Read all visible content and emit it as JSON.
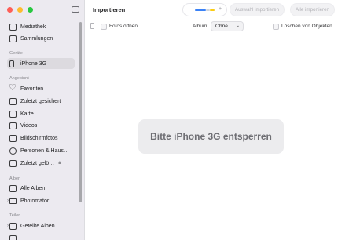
{
  "window": {
    "title": "Importieren"
  },
  "sidebar": {
    "library": [
      {
        "label": "Mediathek",
        "icon": "photos-library-icon"
      },
      {
        "label": "Sammlungen",
        "icon": "collections-icon"
      }
    ],
    "devices_header": "Geräte",
    "devices": [
      {
        "label": "iPhone 3G",
        "icon": "iphone-icon",
        "selected": true
      }
    ],
    "pinned_header": "Angepinnt",
    "pinned": [
      {
        "label": "Favoriten",
        "icon": "heart-icon"
      },
      {
        "label": "Zuletzt gesichert",
        "icon": "recently-saved-icon"
      },
      {
        "label": "Karte",
        "icon": "map-icon"
      },
      {
        "label": "Videos",
        "icon": "video-icon"
      },
      {
        "label": "Bildschirmfotos",
        "icon": "screenshot-icon"
      },
      {
        "label": "Personen & Haus…",
        "icon": "people-icon"
      },
      {
        "label": "Zuletzt gelö…",
        "icon": "trash-icon",
        "locked": true
      }
    ],
    "albums_header": "Alben",
    "albums": [
      {
        "label": "Alle Alben",
        "icon": "albums-icon"
      },
      {
        "label": "Photomator",
        "icon": "folder-icon",
        "expandable": true
      }
    ],
    "sharing_header": "Teilen",
    "sharing": [
      {
        "label": "Geteilte Alben",
        "icon": "shared-albums-icon",
        "expandable": true
      }
    ]
  },
  "toolbar": {
    "import_selected": "Auswahl importieren",
    "import_all": "Alle importieren",
    "open_photos": "Fotos öffnen",
    "album_label": "Album:",
    "album_value": "Ohne",
    "delete_items": "Löschen von Objekten",
    "progress_colors": [
      "#3b82f6",
      "#d1d5db",
      "#facc15"
    ]
  },
  "main": {
    "unlock_message": "Bitte iPhone 3G entsperren"
  }
}
